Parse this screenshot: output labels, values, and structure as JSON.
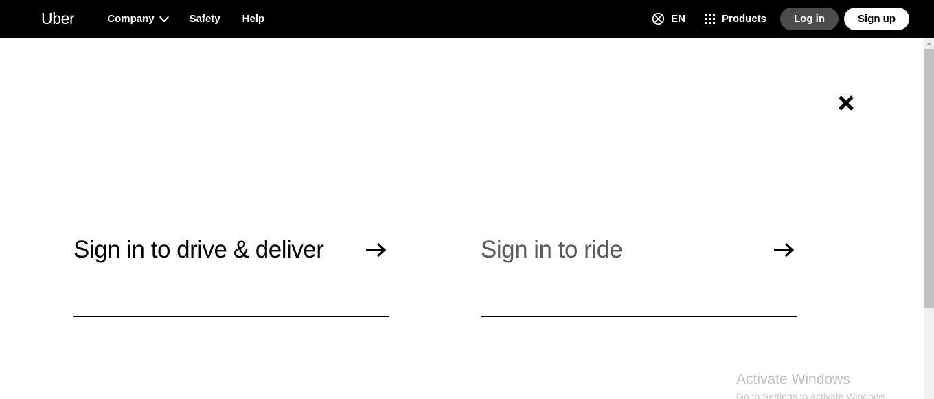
{
  "navbar": {
    "logo": "Uber",
    "links": [
      {
        "label": "Company",
        "icon": "chevron-down-icon",
        "has_chevron": true
      },
      {
        "label": "Safety",
        "has_chevron": false
      },
      {
        "label": "Help",
        "has_chevron": false
      }
    ],
    "language": {
      "icon": "globe-icon",
      "label": "EN"
    },
    "products": {
      "icon": "grid-apps-icon",
      "label": "Products"
    },
    "login_button": "Log in",
    "signup_button": "Sign up",
    "background_color": "#000000",
    "login_button_color": "#4c4c4c",
    "signup_button_color": "#ffffff"
  },
  "main": {
    "close_icon": "close-x-icon",
    "options": [
      {
        "label": "Sign in to drive & deliver",
        "arrow_icon": "arrow-right-icon",
        "text_color": "#000000"
      },
      {
        "label": "Sign in to ride",
        "arrow_icon": "arrow-right-icon",
        "text_color": "#5b5b5b"
      }
    ]
  },
  "watermark": {
    "title": "Activate Windows",
    "subtitle": "Go to Settings to activate Windows."
  },
  "scrollbar": {
    "up_arrow_icon": "scroll-up-arrow-icon",
    "thumb_color": "#c1c1c1",
    "track_color": "#f0f0f0"
  }
}
